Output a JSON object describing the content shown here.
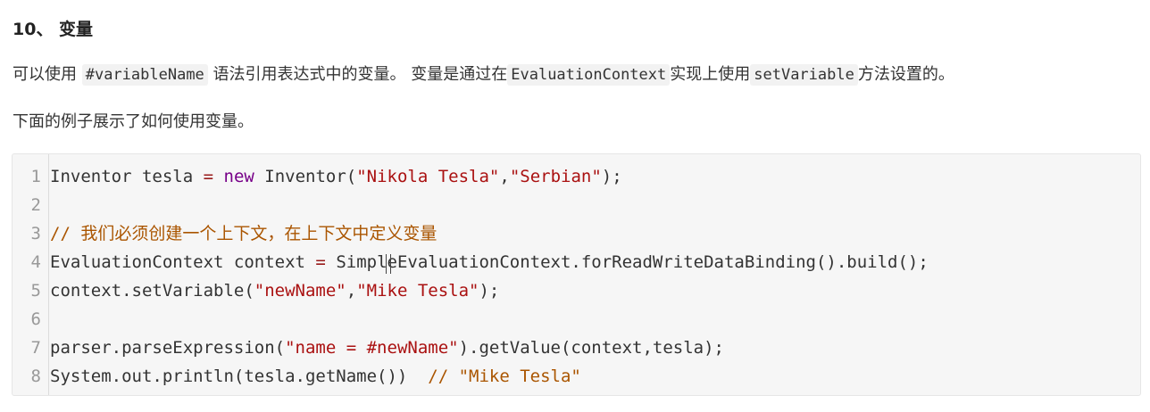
{
  "heading": "10、 变量",
  "para1": {
    "t1": "可以使用 ",
    "c1": "#variableName",
    "t2": " 语法引用表达式中的变量。 变量是通过在",
    "c2": "EvaluationContext",
    "t3": "实现上使用",
    "c3": "setVariable",
    "t4": "方法设置的。"
  },
  "para2": "下面的例子展示了如何使用变量。",
  "code": {
    "lines": [
      {
        "n": "1",
        "tokens": [
          {
            "t": "Inventor tesla ",
            "c": "plain"
          },
          {
            "t": "=",
            "c": "op"
          },
          {
            "t": " ",
            "c": "plain"
          },
          {
            "t": "new",
            "c": "kw"
          },
          {
            "t": " Inventor(",
            "c": "plain"
          },
          {
            "t": "\"Nikola Tesla\"",
            "c": "str"
          },
          {
            "t": ",",
            "c": "plain"
          },
          {
            "t": "\"Serbian\"",
            "c": "str"
          },
          {
            "t": ");",
            "c": "plain"
          }
        ]
      },
      {
        "n": "2",
        "tokens": []
      },
      {
        "n": "3",
        "tokens": [
          {
            "t": "// 我们必须创建一个上下文，在上下文中定义变量",
            "c": "cm"
          }
        ]
      },
      {
        "n": "4",
        "tokens": [
          {
            "t": "EvaluationContext context ",
            "c": "plain"
          },
          {
            "t": "=",
            "c": "op"
          },
          {
            "t": " SimpleEvaluationContext.forReadWriteDataBinding().build();",
            "c": "plain"
          }
        ]
      },
      {
        "n": "5",
        "tokens": [
          {
            "t": "context.setVariable(",
            "c": "plain"
          },
          {
            "t": "\"newName\"",
            "c": "str"
          },
          {
            "t": ",",
            "c": "plain"
          },
          {
            "t": "\"Mike Tesla\"",
            "c": "str"
          },
          {
            "t": ");",
            "c": "plain"
          }
        ]
      },
      {
        "n": "6",
        "tokens": []
      },
      {
        "n": "7",
        "tokens": [
          {
            "t": "parser.parseExpression(",
            "c": "plain"
          },
          {
            "t": "\"name = #newName\"",
            "c": "str"
          },
          {
            "t": ").getValue(context,tesla);",
            "c": "plain"
          }
        ]
      },
      {
        "n": "8",
        "tokens": [
          {
            "t": "System.out.println(tesla.getName())  ",
            "c": "plain"
          },
          {
            "t": "// \"Mike Tesla\"",
            "c": "cm"
          }
        ]
      }
    ]
  }
}
